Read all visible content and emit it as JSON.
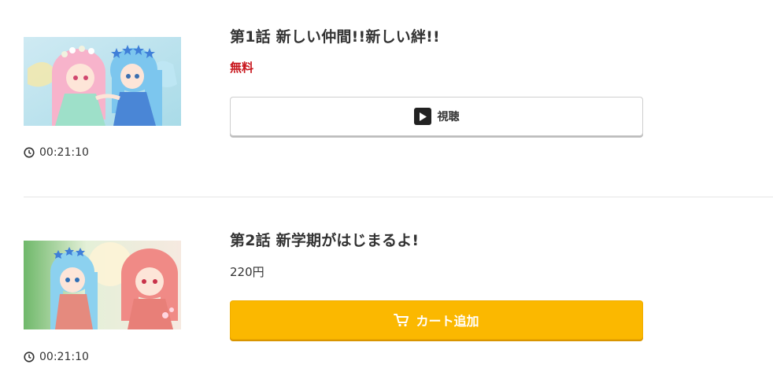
{
  "episodes": [
    {
      "title": "第1話 新しい仲間!!新しい絆!!",
      "price": "無料",
      "duration": "00:21:10",
      "button_label": "視聴",
      "button_icon": "play-icon",
      "price_color": "#c8161d"
    },
    {
      "title": "第2話 新学期がはじまるよ!",
      "price": "220円",
      "duration": "00:21:10",
      "button_label": "カート追加",
      "button_icon": "cart-icon",
      "button_color": "#fbb800"
    }
  ]
}
